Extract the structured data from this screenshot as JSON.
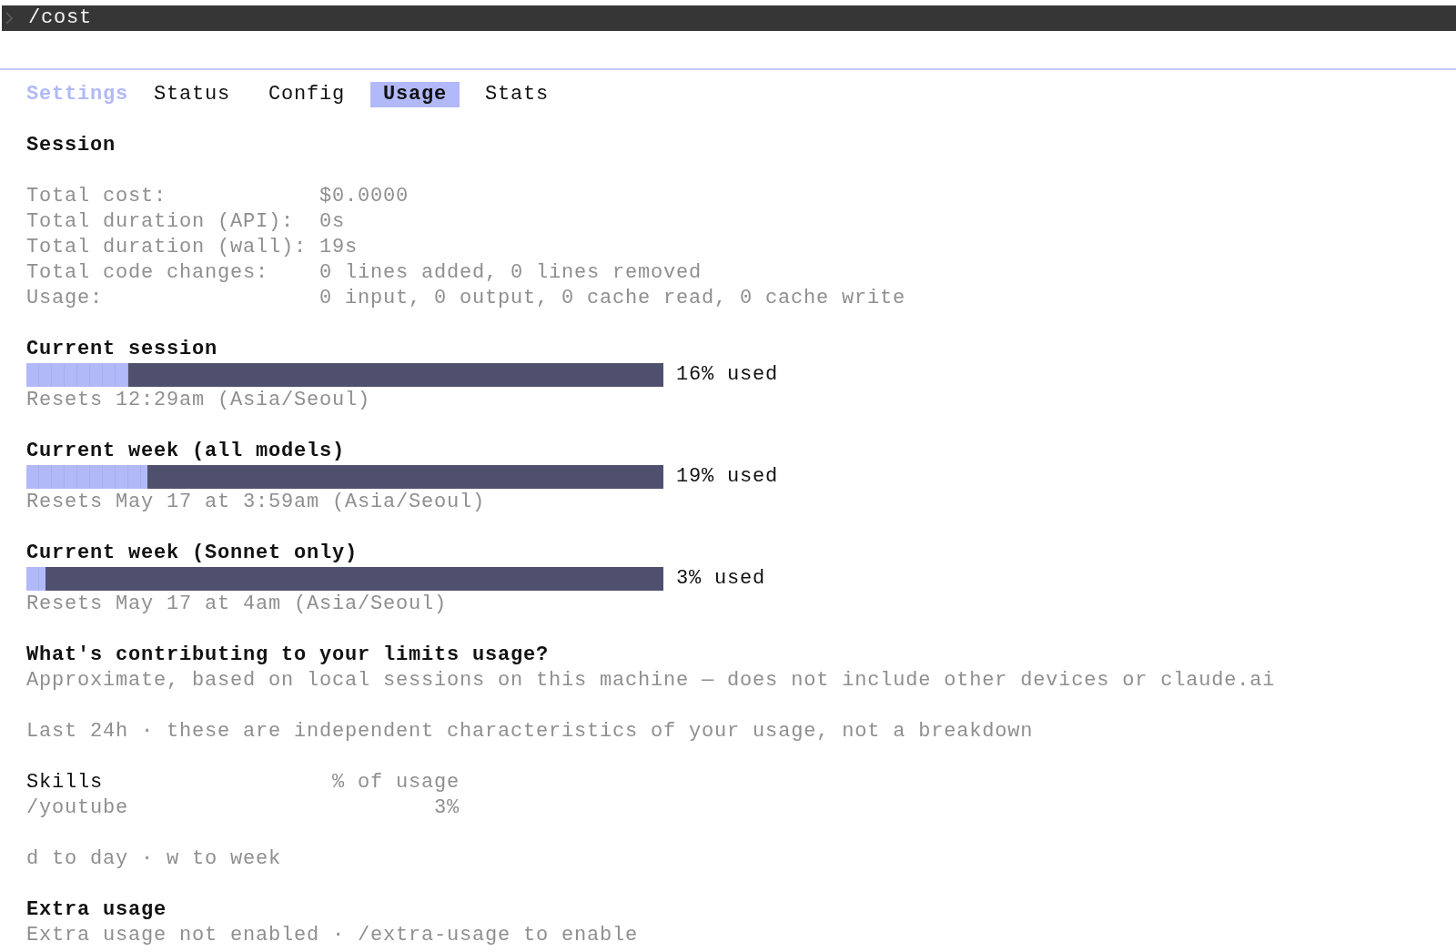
{
  "command_bar": {
    "command": "/cost"
  },
  "panel_title": "Settings",
  "tabs": [
    {
      "label": "Status",
      "selected": false
    },
    {
      "label": "Config",
      "selected": false
    },
    {
      "label": "Usage",
      "selected": true
    },
    {
      "label": "Stats",
      "selected": false
    }
  ],
  "session": {
    "title": "Session",
    "stats": [
      {
        "label": "Total cost:",
        "value": "$0.0000"
      },
      {
        "label": "Total duration (API):",
        "value": "0s"
      },
      {
        "label": "Total duration (wall):",
        "value": "19s"
      },
      {
        "label": "Total code changes:",
        "value": "0 lines added, 0 lines removed"
      },
      {
        "label": "Usage:",
        "value": "0 input, 0 output, 0 cache read, 0 cache write"
      }
    ]
  },
  "limits": [
    {
      "title": "Current session",
      "level": 0.16,
      "reading": "16% used",
      "resets": "Resets 12:29am (Asia/Seoul)"
    },
    {
      "title": "Current week (all models)",
      "level": 0.19,
      "reading": "19% used",
      "resets": "Resets May 17 at 3:59am (Asia/Seoul)"
    },
    {
      "title": "Current week (Sonnet only)",
      "level": 0.03,
      "reading": "3% used",
      "resets": "Resets May 17 at 4am (Asia/Seoul)"
    }
  ],
  "contributing": {
    "title": "What's contributing to your limits usage?",
    "note": "Approximate, based on local sessions on this machine — does not include other devices or claude.ai",
    "period_note": "Last 24h · these are independent characteristics of your usage, not a breakdown",
    "table": {
      "columns": [
        "Skills",
        "% of usage"
      ],
      "rows": [
        {
          "name": "/youtube",
          "share": "3%"
        }
      ]
    },
    "hint": "d to day · w to week"
  },
  "extra_usage": {
    "title": "Extra usage",
    "note": "Extra usage not enabled · /extra-usage to enable"
  }
}
